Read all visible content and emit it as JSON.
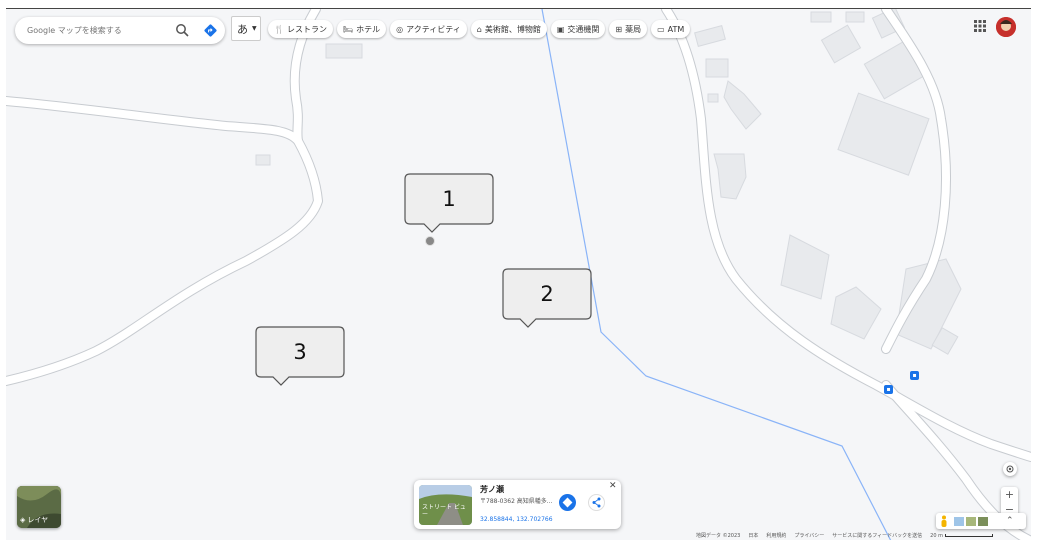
{
  "search": {
    "placeholder": "Google マップを検索する"
  },
  "ime": {
    "label": "あ"
  },
  "chips": [
    {
      "icon": "restaurant-icon",
      "glyph": "🍴",
      "label": "レストラン"
    },
    {
      "icon": "hotel-icon",
      "glyph": "🛏",
      "label": "ホテル"
    },
    {
      "icon": "camera-icon",
      "glyph": "◎",
      "label": "アクティビティ"
    },
    {
      "icon": "museum-icon",
      "glyph": "⌂",
      "label": "美術館、博物館"
    },
    {
      "icon": "transit-icon",
      "glyph": "▣",
      "label": "交通機関"
    },
    {
      "icon": "pharmacy-icon",
      "glyph": "⊞",
      "label": "薬局"
    },
    {
      "icon": "atm-icon",
      "glyph": "▭",
      "label": "ATM"
    }
  ],
  "callouts": [
    {
      "label": "1"
    },
    {
      "label": "2"
    },
    {
      "label": "3"
    }
  ],
  "layers": {
    "label": "レイヤ"
  },
  "place_card": {
    "thumb_label": "ストリート\nビュー",
    "name": "芳ノ瀬",
    "address": "〒788-0362 高知県幡多...",
    "coords": "32.858844, 132.702766",
    "close": "✕"
  },
  "controls": {
    "zoom_in": "+",
    "zoom_out": "−",
    "expand": "⌃"
  },
  "footer": {
    "data": "地図データ ©2023",
    "country": "日本",
    "terms": "利用規約",
    "privacy": "プライバシー",
    "feedback": "サービスに関するフィードバックを送信",
    "scale": "20 m"
  },
  "colors": {
    "accent": "#1a73e8",
    "road": "#ffffff",
    "road_edge": "#c7cbd0",
    "building": "#e8eaed",
    "river": "#8ab4f8"
  }
}
